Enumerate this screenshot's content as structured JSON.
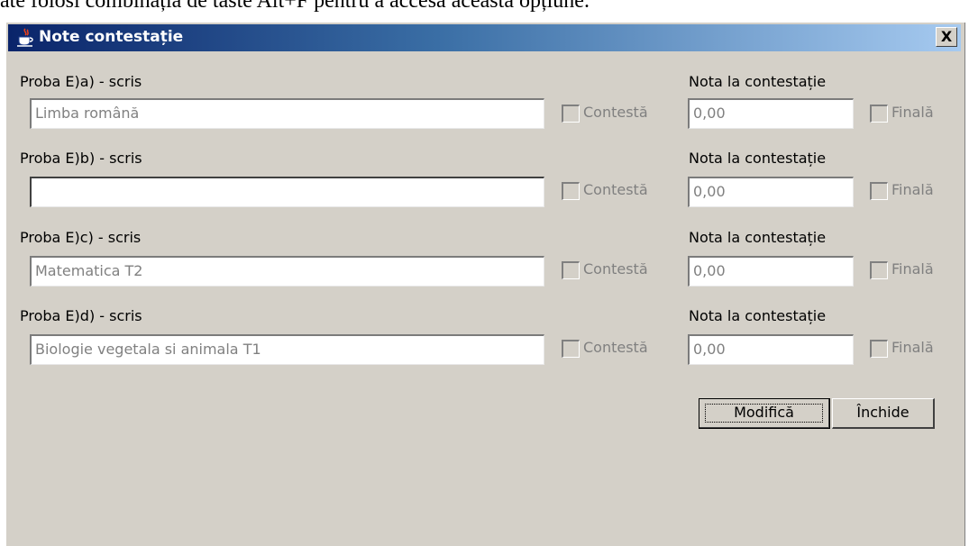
{
  "doc": {
    "snippet": "ate folosi combinația de taste Alt+F pentru a accesa această opțiune."
  },
  "dialog": {
    "title": "Note contestație",
    "close_label": "X"
  },
  "rows": [
    {
      "label": "Proba E)a) - scris",
      "value": "Limba română",
      "contest_label": "Contestă",
      "grade_label": "Nota la contestație",
      "grade_value": "0,00",
      "final_label": "Finală"
    },
    {
      "label": "Proba E)b) - scris",
      "value": "",
      "contest_label": "Contestă",
      "grade_label": "Nota la contestație",
      "grade_value": "0,00",
      "final_label": "Finală"
    },
    {
      "label": "Proba E)c) - scris",
      "value": "Matematica T2",
      "contest_label": "Contestă",
      "grade_label": "Nota la contestație",
      "grade_value": "0,00",
      "final_label": "Finală"
    },
    {
      "label": "Proba E)d) - scris",
      "value": "Biologie vegetala si animala T1",
      "contest_label": "Contestă",
      "grade_label": "Nota la contestație",
      "grade_value": "0,00",
      "final_label": "Finală"
    }
  ],
  "buttons": {
    "modify": "Modifică",
    "close": "Închide"
  },
  "colors": {
    "dialog_bg": "#d4d0c8",
    "title_start": "#0a246a",
    "title_end": "#a6caf0"
  }
}
